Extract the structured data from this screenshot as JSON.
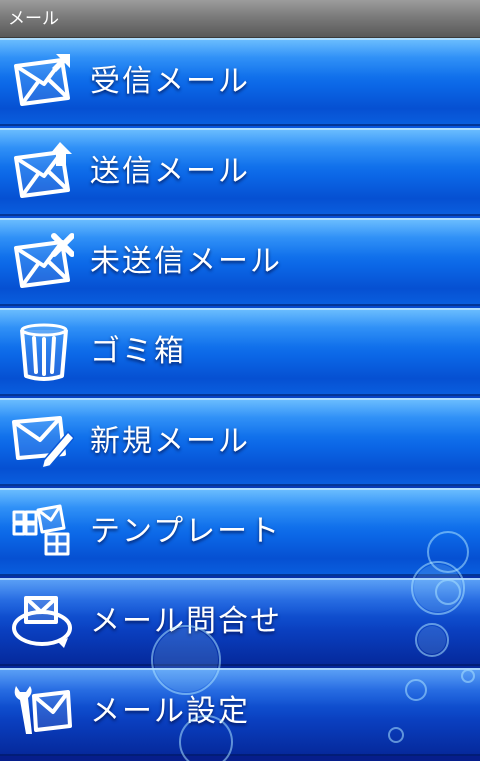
{
  "app": {
    "title": "メール"
  },
  "menu": [
    {
      "label": "受信メール",
      "icon": "mail-inbox-icon"
    },
    {
      "label": "送信メール",
      "icon": "mail-sent-icon"
    },
    {
      "label": "未送信メール",
      "icon": "mail-unsent-icon"
    },
    {
      "label": "ゴミ箱",
      "icon": "trash-icon"
    },
    {
      "label": "新規メール",
      "icon": "mail-compose-icon"
    },
    {
      "label": "テンプレート",
      "icon": "template-icon"
    },
    {
      "label": "メール問合せ",
      "icon": "mail-inquiry-icon"
    },
    {
      "label": "メール設定",
      "icon": "mail-settings-icon"
    }
  ],
  "colors": {
    "accent": "#0b66e6",
    "titlebar": "#7a7a7a",
    "text": "#ffffff"
  }
}
